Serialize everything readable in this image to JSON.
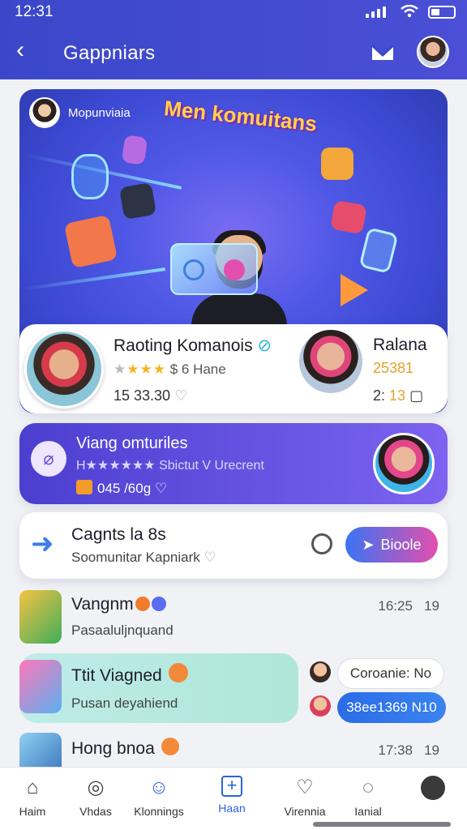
{
  "status": {
    "time": "12:31"
  },
  "header": {
    "title": "Gappniars"
  },
  "hero": {
    "creator_name": "Mopunviaia",
    "headline": "Men komuitans"
  },
  "card_rating": {
    "name": "Raoting Komanois",
    "stars": "★★★",
    "stars_empty": "★",
    "rating_text": "$ 6 Hane",
    "stat": "15 33.30",
    "right_name": "Ralana",
    "right_value": "25381",
    "right_stat_a": "2:",
    "right_stat_b": "13"
  },
  "card_viang": {
    "title": "Viang omturiles",
    "subtitle": "H★★★★★★ Sbictut V Urecrent",
    "value": "045 /60g"
  },
  "card_cagnts": {
    "title": "Cagnts la 8s",
    "subtitle": "Soomunitar Kapniark",
    "button_label": "Bioole"
  },
  "list": [
    {
      "title": "Vangnm",
      "subtitle": "Pasaaluljnquand",
      "time": "16:25",
      "extra": "19"
    },
    {
      "title": "Ttit Viagned",
      "subtitle": "Pusan deyahiend",
      "pill_1": "Coroanie: No",
      "pill_2": "38ee1369 N10"
    },
    {
      "title": "Hong bnoa",
      "time": "17:38",
      "extra": "19"
    }
  ],
  "tabs": [
    {
      "label": "Haim"
    },
    {
      "label": "Vhdas"
    },
    {
      "label": "Klonnings"
    },
    {
      "label": "Haan"
    },
    {
      "label": "Virennia"
    },
    {
      "label": "Ianial"
    }
  ],
  "colors": {
    "primary": "#3b47c9",
    "accent": "#2d64d8",
    "gold": "#f3b521",
    "pink": "#e34fae"
  },
  "icons": [
    "back-arrow-icon",
    "mail-icon",
    "search-icon",
    "share-arrow-icon",
    "link-icon",
    "home-icon",
    "camera-icon",
    "chat-icon",
    "plus-icon",
    "heart-icon",
    "message-icon"
  ]
}
